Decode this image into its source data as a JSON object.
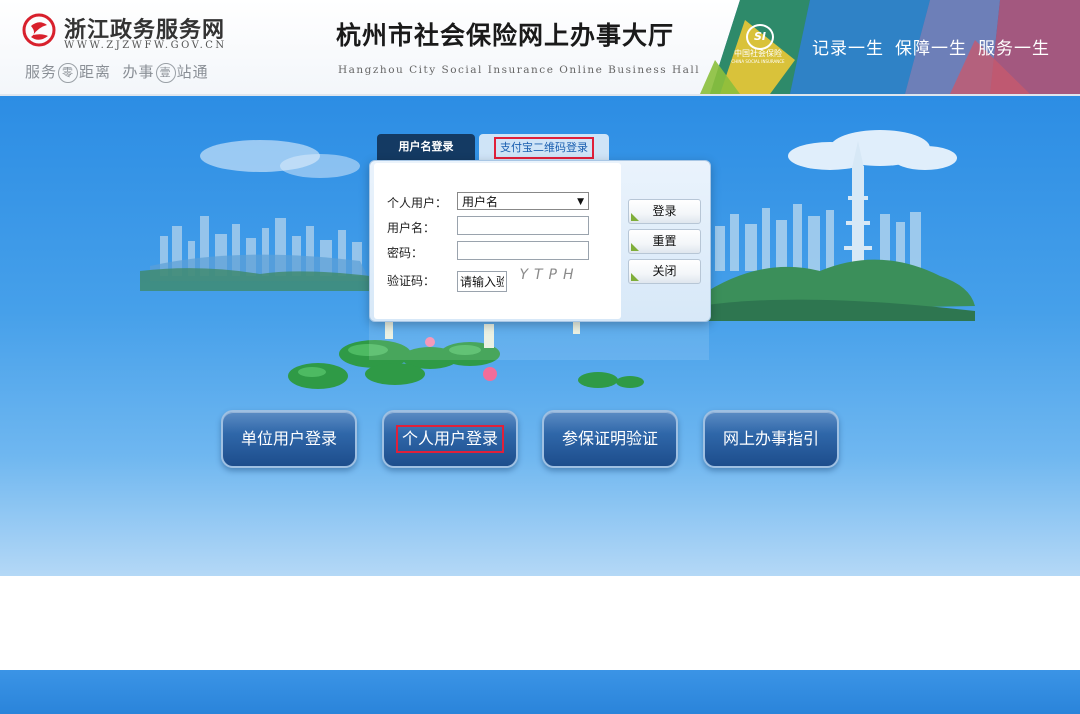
{
  "header": {
    "portal_name": "浙江政务服务网",
    "portal_url": "WWW.ZJZWFW.GOV.CN",
    "portal_slogan": {
      "part1": "服务",
      "circle1": "零",
      "part2": "距离  办事",
      "circle2": "壹",
      "part3": "站通"
    },
    "hall_title": "杭州市社会保险网上办事大厅",
    "hall_subtitle": "Hangzhou City Social Insurance Online Business Hall",
    "si_logo": {
      "mark": "SI",
      "cn": "中国社会保险",
      "en": "CHINA SOCIAL INSURANCE"
    },
    "slogans": [
      "记录一生",
      "保障一生",
      "服务一生"
    ]
  },
  "login": {
    "tabs": [
      {
        "label": "用户名登录",
        "active": true
      },
      {
        "label": "支付宝二维码登录",
        "active": false,
        "highlighted": true
      }
    ],
    "user_type_label": "个人用户：",
    "user_type_value": "用户名",
    "username_label": "用户名：",
    "username_value": "",
    "password_label": "密码：",
    "password_value": "",
    "captcha_label": "验证码：",
    "captcha_placeholder": "请输入验",
    "captcha_text": "YTPH",
    "buttons": {
      "login": "登录",
      "reset": "重置",
      "close": "关闭"
    }
  },
  "big_buttons": [
    {
      "label": "单位用户登录",
      "highlighted": false
    },
    {
      "label": "个人用户登录",
      "highlighted": true
    },
    {
      "label": "参保证明验证",
      "highlighted": false
    },
    {
      "label": "网上办事指引",
      "highlighted": false
    }
  ],
  "colors": {
    "highlight_box": "#e0203a",
    "main_blue": "#2c8de4",
    "tab_active": "#143a63",
    "button_blue": "#2f67a9"
  }
}
